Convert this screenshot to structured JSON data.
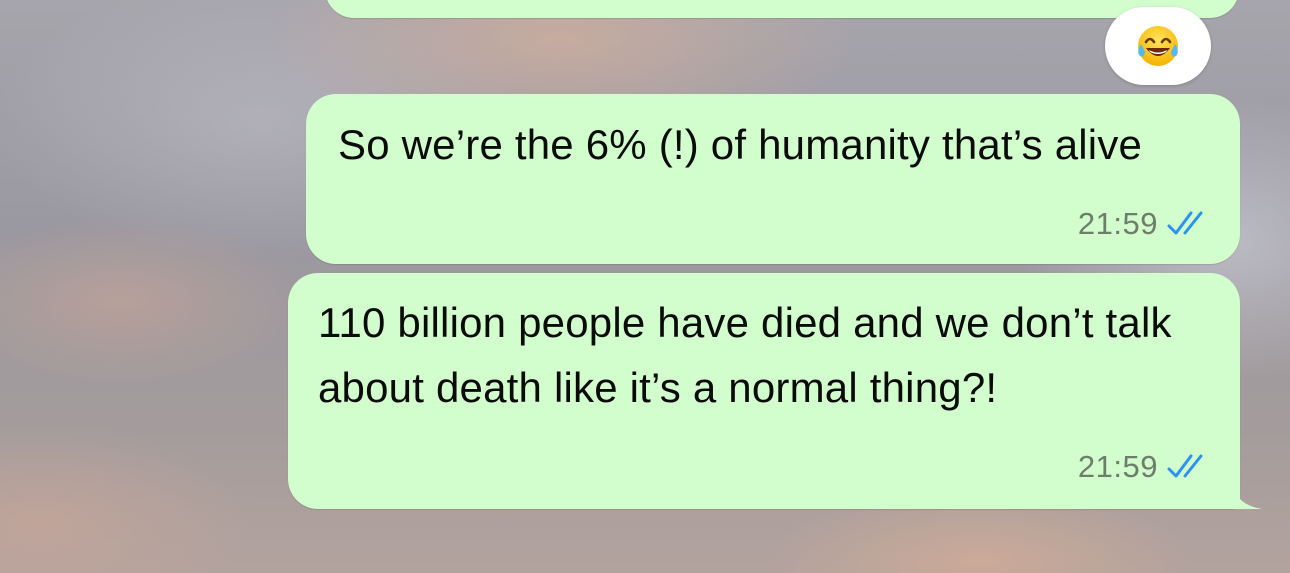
{
  "conversation": {
    "reaction": {
      "emoji": "😂",
      "icon": "face-with-tears-of-joy-icon"
    },
    "messages": [
      {
        "text": "So we’re the 6% (!) of humanity that’s alive",
        "time": "21:59",
        "status": "read",
        "status_icon": "double-check-icon"
      },
      {
        "text": "110 billion people have died and we don’t talk about death like it’s a normal thing?!",
        "time": "21:59",
        "status": "read",
        "status_icon": "double-check-icon"
      }
    ]
  },
  "colors": {
    "outgoing_bubble": "#d2fdcd",
    "read_ticks": "#2c93f0",
    "timestamp": "#6f7d6b"
  }
}
